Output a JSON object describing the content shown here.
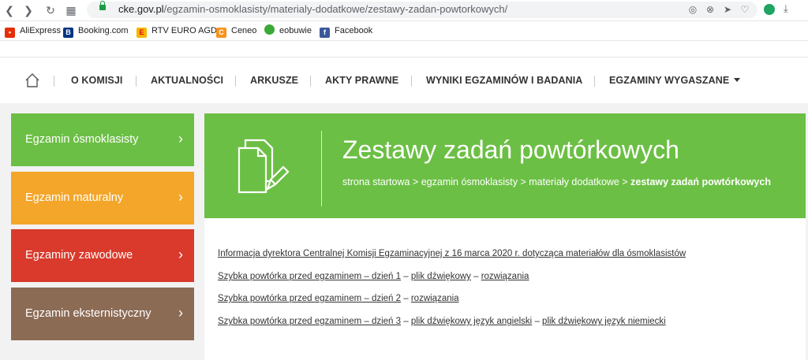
{
  "browser": {
    "url_host": "cke.gov.pl",
    "url_path": "/egzamin-osmoklasisty/materialy-dodatkowe/zestawy-zadan-powtorkowych/",
    "bookmarks": [
      "AliExpress",
      "Booking.com",
      "RTV EURO AGD",
      "Ceneo",
      "eobuwie",
      "Facebook"
    ]
  },
  "nav": {
    "items": [
      "O KOMISJI",
      "AKTUALNOŚCI",
      "ARKUSZE",
      "AKTY PRAWNE",
      "WYNIKI EGZAMINÓW I BADANIA",
      "EGZAMINY WYGASZANE"
    ]
  },
  "sidebar": {
    "items": [
      {
        "label": "Egzamin ósmoklasisty",
        "color": "#6cbf45"
      },
      {
        "label": "Egzamin maturalny",
        "color": "#f4a62a"
      },
      {
        "label": "Egzaminy zawodowe",
        "color": "#d93a2b"
      },
      {
        "label": "Egzamin eksternistyczny",
        "color": "#8c6b55"
      }
    ]
  },
  "banner": {
    "title": "Zestawy zadań powtórkowych",
    "crumbs": [
      "strona startowa",
      "egzamin ósmoklasisty",
      "materiały dodatkowe"
    ],
    "current": "zestawy zadań powtórkowych",
    "sep": " > "
  },
  "content": {
    "info_link": "Informacja dyrektora Centralnej Komisji Egzaminacyjnej z 16 marca 2020 r. dotycząca materiałów dla ósmoklasistów",
    "dash": " – ",
    "rows": [
      {
        "main": "Szybka powtórka przed egzaminem – dzień 1",
        "extra": [
          "plik dźwiękowy",
          "rozwiązania"
        ]
      },
      {
        "main": "Szybka powtórka przed egzaminem – dzień 2",
        "extra": [
          "rozwiązania"
        ]
      },
      {
        "main": "Szybka powtórka przed egzaminem – dzień 3",
        "extra": [
          "plik dźwiękowy język angielski",
          "plik dźwiękowy język niemiecki"
        ]
      }
    ]
  }
}
